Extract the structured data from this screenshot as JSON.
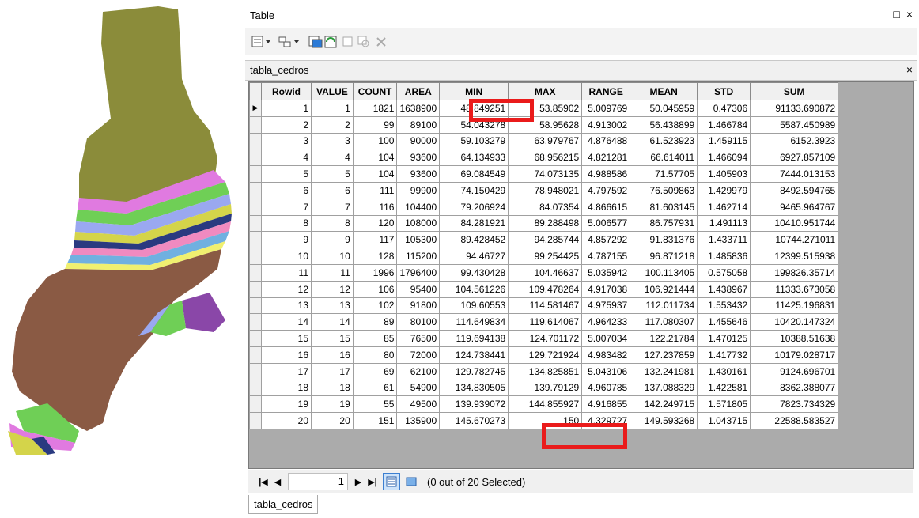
{
  "window": {
    "title": "Table",
    "restore_glyph": "□",
    "close_glyph": "×"
  },
  "toolbar": {
    "icons": [
      "table-options-icon",
      "related-tables-icon",
      "select-by-attributes-icon",
      "switch-selection-icon",
      "clear-selection-icon",
      "zoom-to-selected-icon",
      "delete-selected-icon"
    ]
  },
  "table_tab": {
    "name": "tabla_cedros",
    "close_glyph": "×"
  },
  "columns": [
    "Rowid",
    "VALUE",
    "COUNT",
    "AREA",
    "MIN",
    "MAX",
    "RANGE",
    "MEAN",
    "STD",
    "SUM"
  ],
  "rows": [
    [
      "1",
      "1",
      "1821",
      "1638900",
      "48.849251",
      "53.85902",
      "5.009769",
      "50.045959",
      "0.47306",
      "91133.690872"
    ],
    [
      "2",
      "2",
      "99",
      "89100",
      "54.043278",
      "58.95628",
      "4.913002",
      "56.438899",
      "1.466784",
      "5587.450989"
    ],
    [
      "3",
      "3",
      "100",
      "90000",
      "59.103279",
      "63.979767",
      "4.876488",
      "61.523923",
      "1.459115",
      "6152.3923"
    ],
    [
      "4",
      "4",
      "104",
      "93600",
      "64.134933",
      "68.956215",
      "4.821281",
      "66.614011",
      "1.466094",
      "6927.857109"
    ],
    [
      "5",
      "5",
      "104",
      "93600",
      "69.084549",
      "74.073135",
      "4.988586",
      "71.57705",
      "1.405903",
      "7444.013153"
    ],
    [
      "6",
      "6",
      "111",
      "99900",
      "74.150429",
      "78.948021",
      "4.797592",
      "76.509863",
      "1.429979",
      "8492.594765"
    ],
    [
      "7",
      "7",
      "116",
      "104400",
      "79.206924",
      "84.07354",
      "4.866615",
      "81.603145",
      "1.462714",
      "9465.964767"
    ],
    [
      "8",
      "8",
      "120",
      "108000",
      "84.281921",
      "89.288498",
      "5.006577",
      "86.757931",
      "1.491113",
      "10410.951744"
    ],
    [
      "9",
      "9",
      "117",
      "105300",
      "89.428452",
      "94.285744",
      "4.857292",
      "91.831376",
      "1.433711",
      "10744.271011"
    ],
    [
      "10",
      "10",
      "128",
      "115200",
      "94.46727",
      "99.254425",
      "4.787155",
      "96.871218",
      "1.485836",
      "12399.515938"
    ],
    [
      "11",
      "11",
      "1996",
      "1796400",
      "99.430428",
      "104.46637",
      "5.035942",
      "100.113405",
      "0.575058",
      "199826.35714"
    ],
    [
      "12",
      "12",
      "106",
      "95400",
      "104.561226",
      "109.478264",
      "4.917038",
      "106.921444",
      "1.438967",
      "11333.673058"
    ],
    [
      "13",
      "13",
      "102",
      "91800",
      "109.60553",
      "114.581467",
      "4.975937",
      "112.011734",
      "1.553432",
      "11425.196831"
    ],
    [
      "14",
      "14",
      "89",
      "80100",
      "114.649834",
      "119.614067",
      "4.964233",
      "117.080307",
      "1.455646",
      "10420.147324"
    ],
    [
      "15",
      "15",
      "85",
      "76500",
      "119.694138",
      "124.701172",
      "5.007034",
      "122.21784",
      "1.470125",
      "10388.51638"
    ],
    [
      "16",
      "16",
      "80",
      "72000",
      "124.738441",
      "129.721924",
      "4.983482",
      "127.237859",
      "1.417732",
      "10179.028717"
    ],
    [
      "17",
      "17",
      "69",
      "62100",
      "129.782745",
      "134.825851",
      "5.043106",
      "132.241981",
      "1.430161",
      "9124.696701"
    ],
    [
      "18",
      "18",
      "61",
      "54900",
      "134.830505",
      "139.79129",
      "4.960785",
      "137.088329",
      "1.422581",
      "8362.388077"
    ],
    [
      "19",
      "19",
      "55",
      "49500",
      "139.939072",
      "144.855927",
      "4.916855",
      "142.249715",
      "1.571805",
      "7823.734329"
    ],
    [
      "20",
      "20",
      "151",
      "135900",
      "145.670273",
      "150",
      "4.329727",
      "149.593268",
      "1.043715",
      "22588.583527"
    ]
  ],
  "navigator": {
    "first": "|◀",
    "prev": "◀",
    "page": "1",
    "next": "▶",
    "last": "▶|",
    "status": "(0 out of 20 Selected)"
  },
  "bottom_tab": "tabla_cedros",
  "colors": {
    "highlight": "#ea1b1b",
    "map_upper": "#8b8c3a",
    "map_lower": "#8a5a44",
    "map_right": "#8a47a8"
  }
}
